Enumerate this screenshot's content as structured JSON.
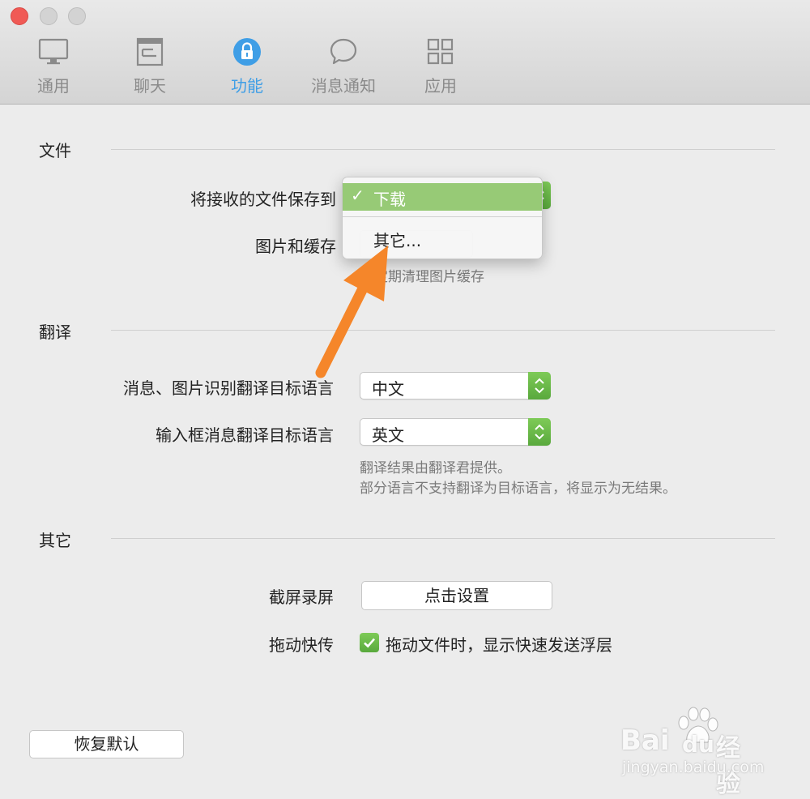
{
  "toolbar": {
    "tabs": [
      {
        "label": "通用",
        "icon": "monitor-icon"
      },
      {
        "label": "聊天",
        "icon": "chat-window-icon"
      },
      {
        "label": "功能",
        "icon": "lock-icon",
        "active": true
      },
      {
        "label": "消息通知",
        "icon": "speech-bubble-icon"
      },
      {
        "label": "应用",
        "icon": "grid-icon"
      }
    ]
  },
  "file_section": {
    "title": "文件",
    "save_to_label": "将接收的文件保存到",
    "images_cache_label": "图片和缓存",
    "cache_hint": "定期清理图片缓存"
  },
  "save_menu": {
    "selected": "下载",
    "other": "其它..."
  },
  "translate_section": {
    "title": "翻译",
    "msg_img_label": "消息、图片识别翻译目标语言",
    "msg_img_value": "中文",
    "input_label": "输入框消息翻译目标语言",
    "input_value": "英文",
    "hint_line1": "翻译结果由翻译君提供。",
    "hint_line2": "部分语言不支持翻译为目标语言，将显示为无结果。"
  },
  "other_section": {
    "title": "其它",
    "screenshot_label": "截屏录屏",
    "screenshot_button": "点击设置",
    "drag_label": "拖动快传",
    "drag_checkbox_label": "拖动文件时，显示快速发送浮层",
    "drag_checked": true
  },
  "restore_button": "恢复默认",
  "watermark": {
    "brand": "Bai",
    "brand2": "du",
    "suffix": "经验",
    "url": "jingyan.baidu.com"
  },
  "colors": {
    "accent_blue": "#3f9ee6",
    "green": "#6ab84a",
    "arrow_orange": "#f5862a"
  }
}
